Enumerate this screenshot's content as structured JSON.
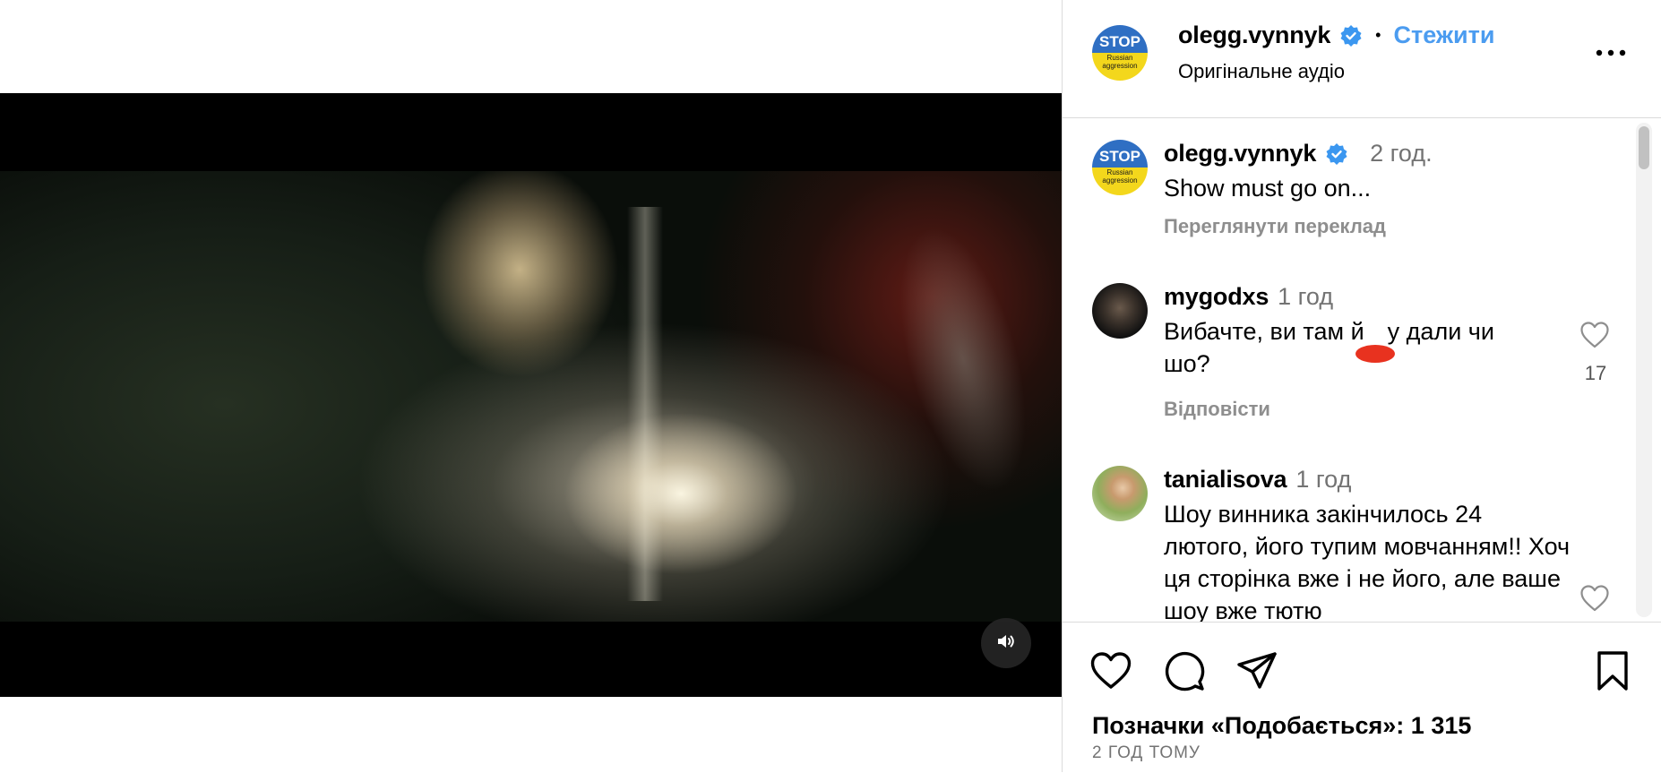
{
  "post": {
    "username": "olegg.vynnyk",
    "follow_label": "Стежити",
    "audio_label": "Оригінальне аудіо",
    "avatar_text": "STOP",
    "avatar_subtext": "Russian aggression"
  },
  "caption": {
    "username": "olegg.vynnyk",
    "time": "2 год.",
    "text": "Show must go on...",
    "translate_label": "Переглянути переклад"
  },
  "comments": [
    {
      "username": "mygodxs",
      "time": "1 год",
      "text_lines": [
        "Вибачте, ви там й",
        "у дали чи",
        "шо?"
      ],
      "action_label": "Відповісти",
      "likes": "17"
    },
    {
      "username": "tanialisova",
      "time": "1 год",
      "text": "Шоу винника закінчилось 24 лютого, його тупим мовчанням!! Хоч ця сторінка вже і не його, але ваше шоу вже тютю"
    }
  ],
  "footer": {
    "likes_text": "Позначки «Подобається»: 1 315",
    "posted_ago": "2 ГОД ТОМУ"
  },
  "icons": {
    "heart": "heart-icon",
    "comment": "comment-icon",
    "share": "share-icon",
    "bookmark": "bookmark-icon",
    "more": "more-icon",
    "volume": "volume-icon",
    "verified": "verified-badge-icon"
  },
  "colors": {
    "accent": "#4b9cf0",
    "verified": "#3b97f0",
    "muted_text": "#737373",
    "divider": "#dbdbdb",
    "redaction": "#e8321f"
  }
}
